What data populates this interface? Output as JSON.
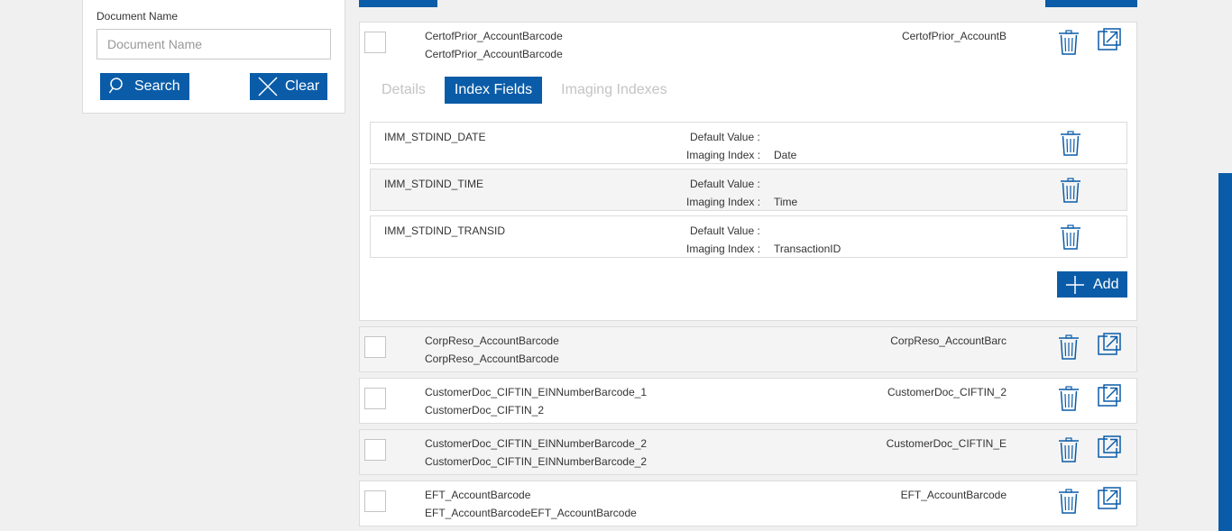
{
  "search_panel": {
    "doc_name_label": "Document Name",
    "doc_name_placeholder": "Document Name",
    "doc_name_value": "",
    "search_label": "Search",
    "clear_label": "Clear"
  },
  "expanded_doc": {
    "name": "CertofPrior_AccountBarcode",
    "description": "CertofPrior_AccountBarcode",
    "code": "CertofPrior_AccountB",
    "tabs": [
      {
        "label": "Details",
        "active": false
      },
      {
        "label": "Index Fields",
        "active": true
      },
      {
        "label": "Imaging Indexes",
        "active": false
      }
    ],
    "default_value_label": "Default Value :",
    "imaging_index_label": "Imaging Index :",
    "index_fields": [
      {
        "name": "IMM_STDIND_DATE",
        "default_value": "",
        "imaging_index": "Date"
      },
      {
        "name": "IMM_STDIND_TIME",
        "default_value": "",
        "imaging_index": "Time"
      },
      {
        "name": "IMM_STDIND_TRANSID",
        "default_value": "",
        "imaging_index": "TransactionID"
      }
    ],
    "add_label": "Add"
  },
  "documents": [
    {
      "name": "CorpReso_AccountBarcode",
      "description": "CorpReso_AccountBarcode",
      "code": "CorpReso_AccountBarc"
    },
    {
      "name": "CustomerDoc_CIFTIN_EINNumberBarcode_1",
      "description": "CustomerDoc_CIFTIN_2",
      "code": "CustomerDoc_CIFTIN_2"
    },
    {
      "name": "CustomerDoc_CIFTIN_EINNumberBarcode_2",
      "description": "CustomerDoc_CIFTIN_EINNumberBarcode_2",
      "code": "CustomerDoc_CIFTIN_E"
    },
    {
      "name": "EFT_AccountBarcode",
      "description": "EFT_AccountBarcodeEFT_AccountBarcode",
      "code": "EFT_AccountBarcode"
    }
  ],
  "icons": {
    "trash": "trash-icon",
    "open": "open-external-icon",
    "search": "search-icon",
    "clear": "close-icon",
    "add": "plus-icon"
  },
  "colors": {
    "primary": "#0a5ca8",
    "background": "#f0f0f0",
    "alt_row": "#f4f4f4",
    "inactive_tab": "#c4c4c4"
  }
}
